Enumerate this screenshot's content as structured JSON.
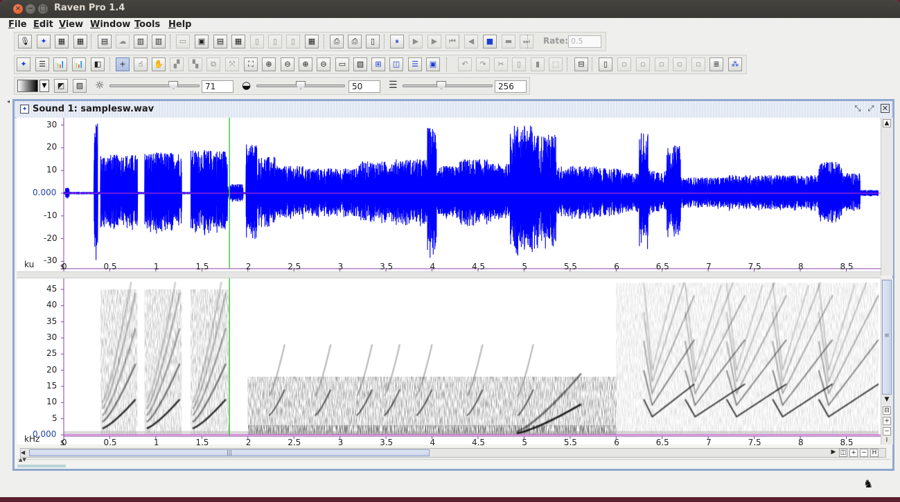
{
  "window": {
    "title": "Raven Pro 1.4",
    "close_glyph": "×",
    "min_glyph": "−",
    "max_glyph": "□"
  },
  "menu": [
    "File",
    "Edit",
    "View",
    "Window",
    "Tools",
    "Help"
  ],
  "toolbar1": {
    "rate_label": "Rate:",
    "rate_value": "0.5",
    "icons": [
      {
        "name": "record-icon",
        "g": "🎙"
      },
      {
        "name": "new-file-icon",
        "g": "✦"
      },
      {
        "name": "view-grid-icon",
        "g": "▦"
      },
      {
        "name": "view-grid-alt-icon",
        "g": "▦"
      },
      {
        "name": "open-icon",
        "g": "▤"
      },
      {
        "name": "cloud-icon",
        "g": "☁"
      },
      {
        "name": "print-icon",
        "g": "▥"
      },
      {
        "name": "print-alt-icon",
        "g": "▥"
      },
      {
        "name": "save-icon",
        "g": "▭"
      },
      {
        "name": "save-as-icon",
        "g": "▣"
      },
      {
        "name": "copy-icon",
        "g": "▤"
      },
      {
        "name": "disk-icon",
        "g": "▦"
      },
      {
        "name": "page-icon",
        "g": "▯"
      },
      {
        "name": "page-alt-icon",
        "g": "▯"
      },
      {
        "name": "page-copy-icon",
        "g": "▯"
      },
      {
        "name": "floppy-icon",
        "g": "▦"
      },
      {
        "name": "printer-icon",
        "g": "⎙"
      },
      {
        "name": "printer-setup-icon",
        "g": "⎙"
      },
      {
        "name": "document-icon",
        "g": "▯"
      },
      {
        "name": "pause-icon",
        "g": "⏸"
      },
      {
        "name": "play-icon",
        "g": "▶"
      },
      {
        "name": "play-to-end-icon",
        "g": "▶"
      },
      {
        "name": "rewind-icon",
        "g": "⏮"
      },
      {
        "name": "back-icon",
        "g": "◀"
      },
      {
        "name": "stop-icon",
        "g": "■"
      },
      {
        "name": "loop-icon",
        "g": "▬"
      },
      {
        "name": "forward-icon",
        "g": "⏭"
      }
    ]
  },
  "toolbar2": {
    "icons": [
      {
        "name": "select-icon",
        "g": "✦"
      },
      {
        "name": "list-icon",
        "g": "☰"
      },
      {
        "name": "histogram-icon",
        "g": "📊"
      },
      {
        "name": "histogram-alt-icon",
        "g": "📊"
      },
      {
        "name": "gradient-icon",
        "g": "◧"
      },
      {
        "name": "crosshair-icon",
        "g": "+"
      },
      {
        "name": "hand-pointer-icon",
        "g": "☝"
      },
      {
        "name": "hand-grab-icon",
        "g": "✋"
      },
      {
        "name": "resize-icon",
        "g": "▞"
      },
      {
        "name": "resize-alt-icon",
        "g": "▚"
      },
      {
        "name": "copy-box-icon",
        "g": "⧉"
      },
      {
        "name": "fit-icon",
        "g": "⤧"
      },
      {
        "name": "fit-all-icon",
        "g": "⛶"
      },
      {
        "name": "zoom-in-icon",
        "g": "⊕"
      },
      {
        "name": "zoom-out-icon",
        "g": "⊖"
      },
      {
        "name": "zoom-in-time-icon",
        "g": "⊕"
      },
      {
        "name": "zoom-out-time-icon",
        "g": "⊖"
      },
      {
        "name": "band-icon",
        "g": "▭"
      },
      {
        "name": "spectrum-icon",
        "g": "▧"
      },
      {
        "name": "grid-icon",
        "g": "⊞"
      },
      {
        "name": "columns-icon",
        "g": "◫"
      },
      {
        "name": "rows-icon",
        "g": "☰"
      },
      {
        "name": "image-icon",
        "g": "▣"
      },
      {
        "name": "undo-icon",
        "g": "↶"
      },
      {
        "name": "redo-icon",
        "g": "↷"
      },
      {
        "name": "cut-icon",
        "g": "✂"
      },
      {
        "name": "paste-icon",
        "g": "▯"
      },
      {
        "name": "trash-icon",
        "g": "▮"
      },
      {
        "name": "select-box-icon",
        "g": "⬚"
      },
      {
        "name": "minus-red-icon",
        "g": "⊟"
      },
      {
        "name": "doc-icon",
        "g": "▯"
      },
      {
        "name": "tile-a-icon",
        "g": "▫"
      },
      {
        "name": "tile-b-icon",
        "g": "▫"
      },
      {
        "name": "tile-c-icon",
        "g": "▫"
      },
      {
        "name": "tile-d-icon",
        "g": "▫"
      },
      {
        "name": "tile-e-icon",
        "g": "▫"
      },
      {
        "name": "lines-icon",
        "g": "≣"
      },
      {
        "name": "waveform-icon",
        "g": "⁂"
      }
    ]
  },
  "toolbar3": {
    "brightness_value": "71",
    "contrast_value": "50",
    "resolution_value": "256",
    "brightness_fraction": 0.71,
    "contrast_fraction": 0.5,
    "resolution_fraction": 0.43
  },
  "sound_window": {
    "title": "Sound 1: samplesw.wav",
    "waveform": {
      "unit_label": "ku",
      "y_ticks": [
        "30",
        "20",
        "10",
        "0.000",
        "-10",
        "-20",
        "-30"
      ],
      "ylim": [
        -32,
        32
      ]
    },
    "spectrogram": {
      "unit_label": "kHz",
      "y_ticks": [
        "45",
        "40",
        "35",
        "30",
        "25",
        "20",
        "15",
        "10",
        "5",
        "0.000"
      ],
      "ylim": [
        0,
        48
      ]
    },
    "time_axis": {
      "unit_label": "s",
      "ticks": [
        "0",
        "0.5",
        "1",
        "1.5",
        "2",
        "2.5",
        "3",
        "3.5",
        "4",
        "4.5",
        "5",
        "5.5",
        "6",
        "6.5",
        "7",
        "7.5",
        "8",
        "8.5"
      ],
      "xlim": [
        0,
        8.85
      ]
    },
    "cursor_time": 1.8,
    "colors": {
      "waveform": "#0000ff",
      "cursor": "#44cc44",
      "baseline": "#cc33cc",
      "frame": "#8fa8cf"
    }
  }
}
